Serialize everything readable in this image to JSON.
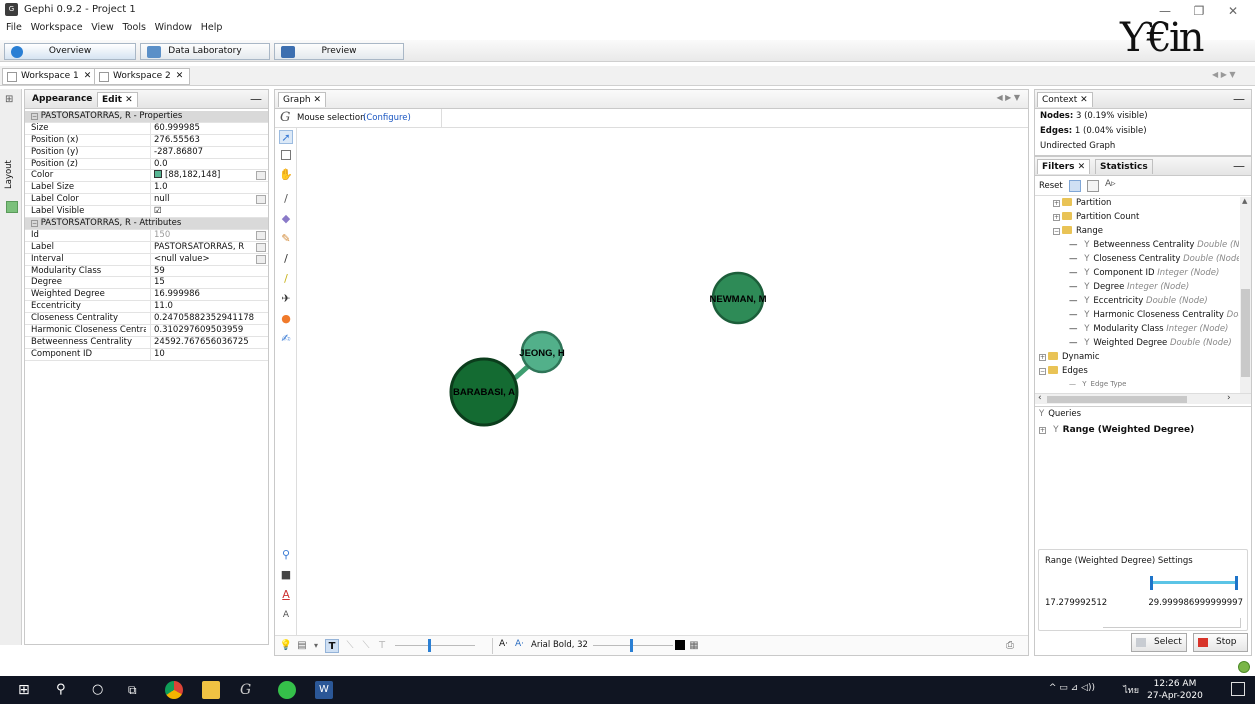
{
  "window": {
    "title": "Gephi 0.9.2 - Project 1",
    "app_icon_text": "G",
    "minimize": "—",
    "maximize": "❐",
    "close": "✕"
  },
  "menu": [
    "File",
    "Workspace",
    "View",
    "Tools",
    "Window",
    "Help"
  ],
  "modes": {
    "overview": "Overview",
    "data_lab": "Data Laboratory",
    "preview": "Preview"
  },
  "logo_text": "Ƴ€in",
  "workspaces": [
    {
      "label": "Workspace 1",
      "close": "✕"
    },
    {
      "label": "Workspace 2",
      "close": "✕"
    }
  ],
  "ws_nav": "◀ ▶ ▼",
  "left_strip": {
    "label": "Layout"
  },
  "left_panel": {
    "tab_appearance": "Appearance",
    "tab_edit": "Edit",
    "close": "✕",
    "minimize": "—",
    "properties_header": "PASTORSATORRAS, R - Properties",
    "properties": [
      {
        "key": "Size",
        "value": "60.999985"
      },
      {
        "key": "Position (x)",
        "value": "276.55563"
      },
      {
        "key": "Position (y)",
        "value": "-287.86807"
      },
      {
        "key": "Position (z)",
        "value": "0.0"
      },
      {
        "key": "Color",
        "value": "[88,182,148]",
        "color": "#58b694"
      },
      {
        "key": "Label Size",
        "value": "1.0"
      },
      {
        "key": "Label Color",
        "value": "null"
      },
      {
        "key": "Label Visible",
        "value": "☑"
      }
    ],
    "attributes_header": "PASTORSATORRAS, R - Attributes",
    "attributes": [
      {
        "key": "Id",
        "value": "150"
      },
      {
        "key": "Label",
        "value": "PASTORSATORRAS, R"
      },
      {
        "key": "Interval",
        "value": "<null value>"
      },
      {
        "key": "Modularity Class",
        "value": "59"
      },
      {
        "key": "Degree",
        "value": "15"
      },
      {
        "key": "Weighted Degree",
        "value": "16.999986"
      },
      {
        "key": "Eccentricity",
        "value": "11.0"
      },
      {
        "key": "Closeness Centrality",
        "value": "0.24705882352941178"
      },
      {
        "key": "Harmonic Closeness Centrality",
        "value": "0.310297609503959"
      },
      {
        "key": "Betweenness Centrality",
        "value": "24592.767656036725"
      },
      {
        "key": "Component ID",
        "value": "10"
      }
    ]
  },
  "graph": {
    "tab": "Graph",
    "close": "✕",
    "nav": "◀ ▶ ▼",
    "toolbar_label": "Mouse selection",
    "configure": "(Configure)",
    "nodes": [
      {
        "label": "NEWMAN, M",
        "fill": "#2e8b57",
        "stroke": "#1c5e3a"
      },
      {
        "label": "JEONG, H",
        "fill": "#52b08a",
        "stroke": "#2f7558"
      },
      {
        "label": "BARABASI, A",
        "fill": "#146b32",
        "stroke": "#0b3d1c"
      }
    ],
    "edge_color": "#3e9e70",
    "font_label": "Arial Bold, 32",
    "font_a1": "A·",
    "font_a2": "A·"
  },
  "context": {
    "tab": "Context",
    "close": "✕",
    "minimize": "—",
    "nodes_label": "Nodes:",
    "nodes_value": "3 (0.19% visible)",
    "edges_label": "Edges:",
    "edges_value": "1 (0.04% visible)",
    "graph_type": "Undirected Graph"
  },
  "filters": {
    "tab_filters": "Filters",
    "tab_statistics": "Statistics",
    "close": "✕",
    "minimize": "—",
    "reset": "Reset",
    "tree": [
      {
        "label": "Partition",
        "type": "folder"
      },
      {
        "label": "Partition Count",
        "type": "folder"
      },
      {
        "label": "Range",
        "type": "folder-open"
      },
      {
        "label": "Betweenness Centrality",
        "hint": "Double (No",
        "type": "leaf"
      },
      {
        "label": "Closeness Centrality",
        "hint": "Double (Node,",
        "type": "leaf"
      },
      {
        "label": "Component ID",
        "hint": "Integer (Node)",
        "type": "leaf"
      },
      {
        "label": "Degree",
        "hint": "Integer (Node)",
        "type": "leaf"
      },
      {
        "label": "Eccentricity",
        "hint": "Double (Node)",
        "type": "leaf"
      },
      {
        "label": "Harmonic Closeness Centrality",
        "hint": "Dou",
        "type": "leaf"
      },
      {
        "label": "Modularity Class",
        "hint": "Integer (Node)",
        "type": "leaf"
      },
      {
        "label": "Weighted Degree",
        "hint": "Double (Node)",
        "type": "leaf"
      },
      {
        "label": "Dynamic",
        "type": "folder"
      },
      {
        "label": "Edges",
        "type": "folder-open"
      },
      {
        "label": "Edge Type",
        "type": "leaf-cut"
      }
    ],
    "queries_label": "Queries",
    "query_item": "Range (Weighted Degree)",
    "settings_title": "Range (Weighted Degree) Settings",
    "range_min": "17.279992512",
    "range_max": "29.999986999999997",
    "range_low_fraction": 0.55,
    "range_high_fraction": 1.0,
    "select": "Select",
    "stop": "Stop"
  },
  "taskbar": {
    "time": "12:26 AM",
    "date": "27-Apr-2020",
    "lang": "ไทย",
    "tray_icons": "^ ▭ ⊿ ◁))"
  }
}
